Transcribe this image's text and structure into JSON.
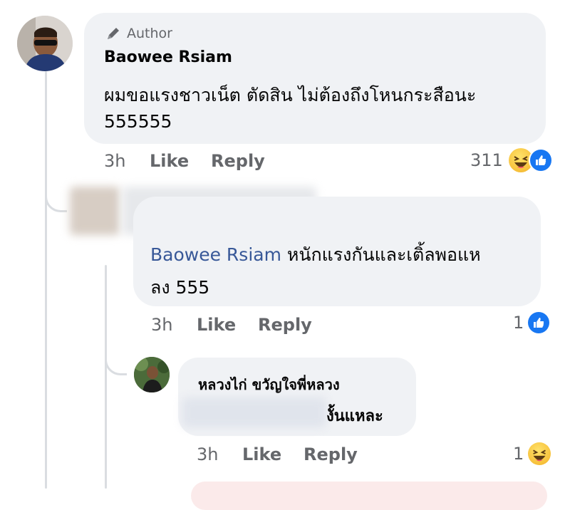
{
  "comment1": {
    "badge": "Author",
    "author_name": "Baowee Rsiam",
    "text_line1": "ผมขอแรงชาวเน็ต ตัดสิน ไม่ต้องถึงโหนกระสือนะ",
    "text_line2": "555555",
    "time": "3h",
    "like_label": "Like",
    "reply_label": "Reply",
    "reaction_count": "311",
    "reactions": [
      "haha-icon",
      "like-icon"
    ]
  },
  "reply1": {
    "mention": "Baowee Rsiam",
    "text_line1_rest": " หนักแรงกันและเติ้ลพอแห",
    "text_line2": "ลง 555",
    "time": "3h",
    "like_label": "Like",
    "reply_label": "Reply",
    "reaction_count": "1",
    "reactions": [
      "like-icon"
    ]
  },
  "reply2": {
    "author_name": "หลวงไก่ ขวัญใจพี่หลวง",
    "text_visible": "งั้นแหละ",
    "time": "3h",
    "like_label": "Like",
    "reply_label": "Reply",
    "reaction_count": "1",
    "reactions": [
      "haha-icon"
    ]
  },
  "colors": {
    "bubble": "#f0f2f5",
    "secondary_text": "#65676b",
    "mention": "#385898",
    "like_blue": "#1877f2",
    "thread_line": "#dadde1"
  }
}
